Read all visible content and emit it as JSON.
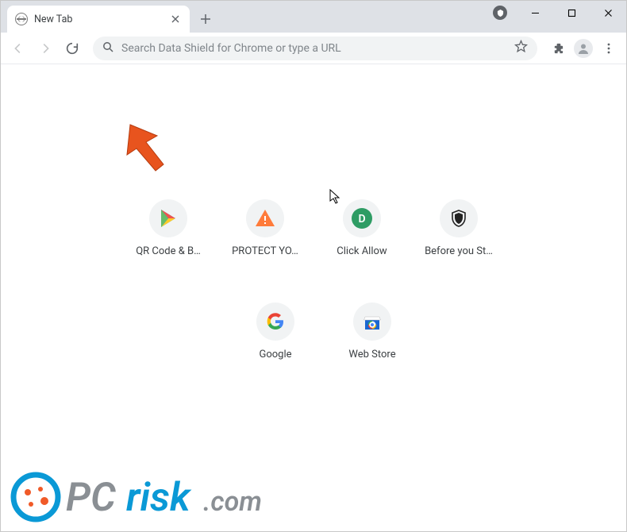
{
  "window": {
    "title": "New Tab"
  },
  "tab": {
    "title": "New Tab"
  },
  "omnibox": {
    "placeholder": "Search Data Shield for Chrome or type a URL"
  },
  "shortcuts_row1": [
    {
      "label": "QR Code & B…",
      "icon": "play-icon"
    },
    {
      "label": "PROTECT YO…",
      "icon": "warning-icon"
    },
    {
      "label": "Click Allow",
      "icon": "letter-d-icon"
    },
    {
      "label": "Before you St…",
      "icon": "shield-icon"
    }
  ],
  "shortcuts_row2": [
    {
      "label": "Google",
      "icon": "google-icon"
    },
    {
      "label": "Web Store",
      "icon": "webstore-icon"
    }
  ],
  "watermark": {
    "text": "PCrisk.com"
  },
  "colors": {
    "tabstrip": "#dee1e6",
    "omnibox_bg": "#f1f3f4",
    "text_muted": "#80868b",
    "arrow": "#e8541e"
  }
}
